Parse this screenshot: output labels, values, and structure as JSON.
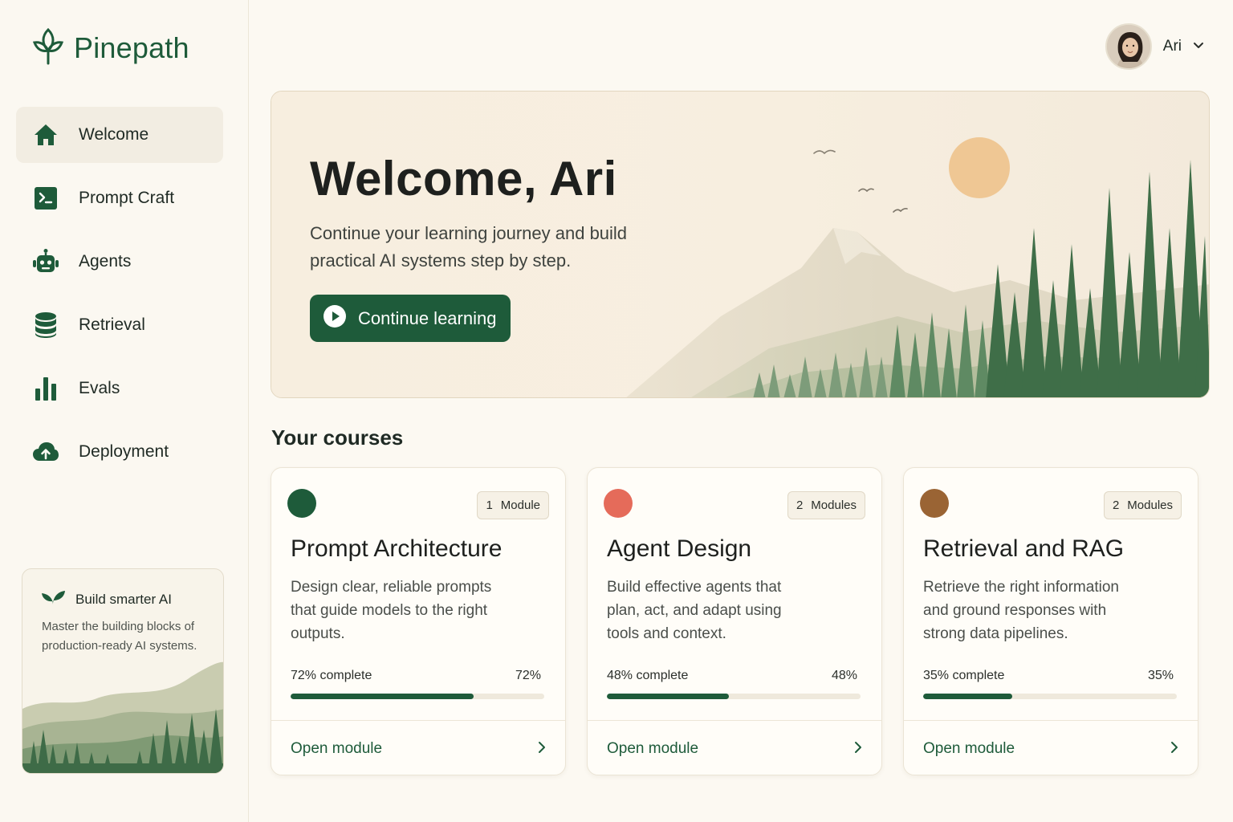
{
  "brand": {
    "name": "Pinepath",
    "color": "#1e5b3a"
  },
  "sidebar": {
    "items": [
      {
        "label": "Welcome",
        "icon": "home-icon",
        "active": true
      },
      {
        "label": "Prompt Craft",
        "icon": "terminal-icon",
        "active": false
      },
      {
        "label": "Agents",
        "icon": "robot-icon",
        "active": false
      },
      {
        "label": "Retrieval",
        "icon": "database-icon",
        "active": false
      },
      {
        "label": "Evals",
        "icon": "bar-chart-icon",
        "active": false
      },
      {
        "label": "Deployment",
        "icon": "cloud-upload-icon",
        "active": false
      }
    ],
    "promo": {
      "title": "Build smarter AI",
      "text": "Master the building blocks of production-ready AI systems.",
      "icon": "sprout-icon"
    }
  },
  "user": {
    "name": "Ari",
    "icon": "chevron-down-icon"
  },
  "hero": {
    "title": "Welcome, Ari",
    "subtitle": "Continue your learning journey and build practical AI systems step by step.",
    "button_label": "Continue learning",
    "button_icon": "play-icon"
  },
  "courses": {
    "section_title": "Your courses",
    "items": [
      {
        "dot_color": "#1e5b3a",
        "badge_count": "1",
        "badge_label": "Module",
        "title": "Prompt Architecture",
        "description": "Design clear, reliable prompts that guide models to the right outputs.",
        "progress_label": "72% complete",
        "progress_pct": "72%",
        "progress": 0.72,
        "link_label": "Open module"
      },
      {
        "dot_color": "#e56b5a",
        "badge_count": "2",
        "badge_label": "Modules",
        "title": "Agent Design",
        "description": "Build effective agents that plan, act, and adapt using tools and context.",
        "progress_label": "48% complete",
        "progress_pct": "48%",
        "progress": 0.48,
        "link_label": "Open module"
      },
      {
        "dot_color": "#9a6434",
        "badge_count": "2",
        "badge_label": "Modules",
        "title": "Retrieval and RAG",
        "description": "Retrieve the right information and ground responses with strong data pipelines.",
        "progress_label": "35% complete",
        "progress_pct": "35%",
        "progress": 0.35,
        "link_label": "Open module"
      }
    ]
  }
}
